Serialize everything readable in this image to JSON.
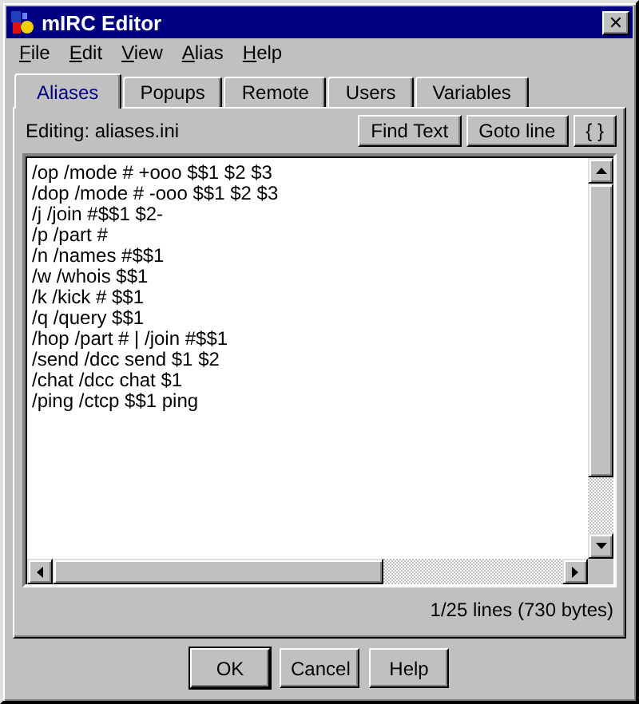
{
  "window": {
    "title": "mIRC Editor",
    "close": "✕"
  },
  "menu": [
    "File",
    "Edit",
    "View",
    "Alias",
    "Help"
  ],
  "tabs": [
    {
      "label": "Aliases",
      "selected": true
    },
    {
      "label": "Popups",
      "selected": false
    },
    {
      "label": "Remote",
      "selected": false
    },
    {
      "label": "Users",
      "selected": false
    },
    {
      "label": "Variables",
      "selected": false
    }
  ],
  "editing": "Editing: aliases.ini",
  "tools": [
    "Find Text",
    "Goto line",
    "{ }"
  ],
  "lines": [
    "/op /mode # +ooo $$1 $2 $3",
    "/dop /mode # -ooo $$1 $2 $3",
    "/j /join #$$1 $2-",
    "/p /part #",
    "/n /names #$$1",
    "/w /whois $$1",
    "/k /kick # $$1",
    "/q /query $$1",
    "/hop /part # | /join #$$1",
    "/send /dcc send $1 $2",
    "/chat /dcc chat $1",
    "/ping /ctcp $$1 ping"
  ],
  "status": "1/25 lines (730 bytes)",
  "buttons": [
    {
      "label": "OK",
      "default": true
    },
    {
      "label": "Cancel",
      "default": false
    },
    {
      "label": "Help",
      "default": false
    }
  ]
}
